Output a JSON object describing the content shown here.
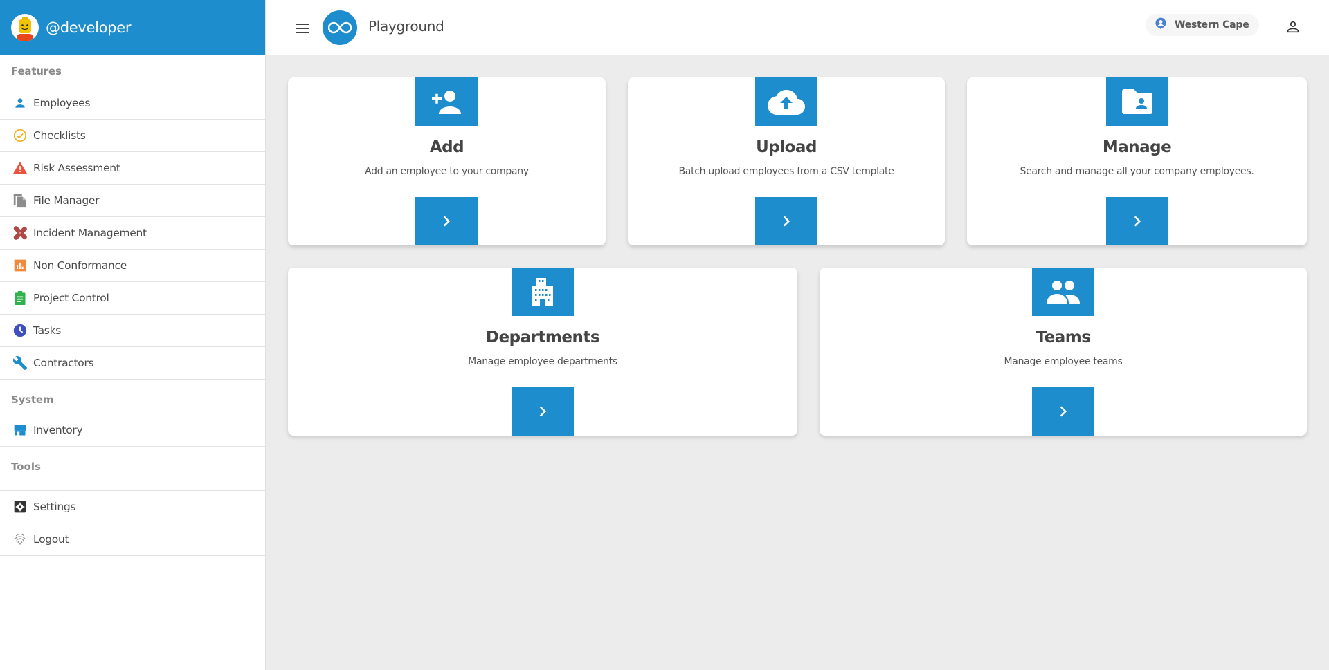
{
  "sidebar": {
    "username": "@developer",
    "sections": {
      "features": "Features",
      "system": "System",
      "tools": "Tools"
    },
    "features_items": [
      {
        "label": "Employees",
        "icon": "person-icon",
        "color": "#1e8dcd"
      },
      {
        "label": "Checklists",
        "icon": "check-circle-icon",
        "color": "#f0b429"
      },
      {
        "label": "Risk Assessment",
        "icon": "warning-icon",
        "color": "#e8533f"
      },
      {
        "label": "File Manager",
        "icon": "file-copy-icon",
        "color": "#8c8c8c"
      },
      {
        "label": "Incident Management",
        "icon": "bandage-icon",
        "color": "#b04848"
      },
      {
        "label": "Non Conformance",
        "icon": "bar-chart-icon",
        "color": "#f08a3c"
      },
      {
        "label": "Project Control",
        "icon": "clipboard-icon",
        "color": "#2fb24c"
      },
      {
        "label": "Tasks",
        "icon": "clock-icon",
        "color": "#3f4fbf"
      },
      {
        "label": "Contractors",
        "icon": "wrench-icon",
        "color": "#1e8dcd"
      }
    ],
    "system_items": [
      {
        "label": "Inventory",
        "icon": "store-icon",
        "color": "#1e8dcd"
      }
    ],
    "bottom_items": [
      {
        "label": "Settings",
        "icon": "settings-icon",
        "color": "#333333"
      },
      {
        "label": "Logout",
        "icon": "fingerprint-icon",
        "color": "#888888"
      }
    ]
  },
  "header": {
    "app_name": "Playground",
    "location": "Western Cape"
  },
  "cards": [
    {
      "title": "Add",
      "description": "Add an employee to your company",
      "icon": "person-add-icon"
    },
    {
      "title": "Upload",
      "description": "Batch upload employees from a CSV template",
      "icon": "cloud-upload-icon"
    },
    {
      "title": "Manage",
      "description": "Search and manage all your company employees.",
      "icon": "folder-shared-icon"
    },
    {
      "title": "Departments",
      "description": "Manage employee departments",
      "icon": "building-icon"
    },
    {
      "title": "Teams",
      "description": "Manage employee teams",
      "icon": "people-icon"
    }
  ],
  "colors": {
    "accent": "#1e8dcd",
    "background": "#ececec"
  }
}
